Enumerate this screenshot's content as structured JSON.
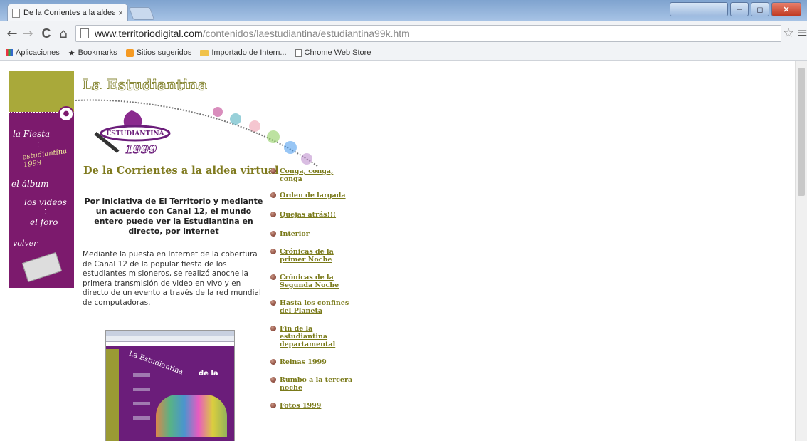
{
  "browser": {
    "tab_title": "De la Corrientes a la aldea",
    "tab_close": "×",
    "window_user": "",
    "url_host": "www.territoriodigital.com",
    "url_path": "/contenidos/laestudiantina/estudiantina99k.htm",
    "nav": {
      "back": "←",
      "forward": "→",
      "reload": "C",
      "home": "⌂"
    },
    "star": "☆",
    "menu": "≡",
    "bookmarks": [
      {
        "label": "Aplicaciones",
        "icon": "apps-grid-icon"
      },
      {
        "label": "Bookmarks",
        "icon": "star-icon"
      },
      {
        "label": "Sitios sugeridos",
        "icon": "suggested-sites-icon"
      },
      {
        "label": "Importado de Intern...",
        "icon": "folder-icon"
      },
      {
        "label": "Chrome Web Store",
        "icon": "page-icon"
      }
    ]
  },
  "page": {
    "brand_title": "La Estudiantina",
    "logo_text": "ESTUDIANTINA",
    "logo_year": "1999",
    "leftnav": [
      {
        "label": "la Fiesta"
      },
      {
        "label": "estudiantina 1999"
      },
      {
        "label": "el álbum"
      },
      {
        "label": "los videos"
      },
      {
        "label": "el foro"
      },
      {
        "label": "volver"
      }
    ],
    "headline": "De la Corrientes a la aldea virtual",
    "lead": "Por iniciativa de El Territorio y mediante un acuerdo con Canal 12, el mundo entero puede ver la Estudiantina en directo, por Internet",
    "body": "Mediante la puesta en Internet de la cobertura de Canal 12 de la popular fiesta de los estudiantes misioneros, se realizó anoche la primera transmisión de video en vivo y en directo de un evento a través de la red mundial de computadoras.",
    "screenshot_caption": "La Estudiantina",
    "screenshot_side": "de la",
    "links": [
      "Conga, conga, conga",
      "Orden de largada",
      "Quejas atrás!!!",
      "Interior",
      "Crónicas de la primer Noche",
      "Crónicas de la Segunda Noche",
      "Hasta los confines del Planeta",
      "Fin de la estudiantina departamental",
      "Reinas 1999",
      "Rumbo a la tercera noche",
      "Fotos 1999"
    ]
  },
  "colors": {
    "purple": "#7c1a6d",
    "olive": "#a9a93a",
    "link": "#7a7a1a"
  }
}
